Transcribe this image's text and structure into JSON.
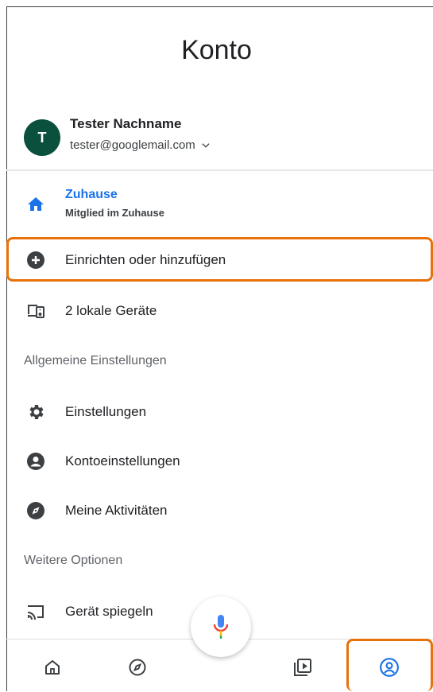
{
  "header": {
    "title": "Konto"
  },
  "account": {
    "avatar_initial": "T",
    "name": "Tester Nachname",
    "email": "tester@googlemail.com",
    "avatar_color": "#0b4f3d"
  },
  "home": {
    "title": "Zuhause",
    "subtitle": "Mitglied im Zuhause",
    "accent": "#1a73e8"
  },
  "menu": {
    "setup_label": "Einrichten oder hinzufügen",
    "local_devices_label": "2 lokale Geräte",
    "general_section": "Allgemeine Einstellungen",
    "settings_label": "Einstellungen",
    "account_settings_label": "Kontoeinstellungen",
    "activities_label": "Meine Aktivitäten",
    "more_section": "Weitere Optionen",
    "cast_label": "Gerät spiegeln"
  },
  "bottom_nav": {
    "items": [
      "home-icon",
      "explore-icon",
      "media-icon",
      "account-icon"
    ],
    "active": "account-icon",
    "active_color": "#1a73e8",
    "highlight_color": "#e8710a"
  }
}
